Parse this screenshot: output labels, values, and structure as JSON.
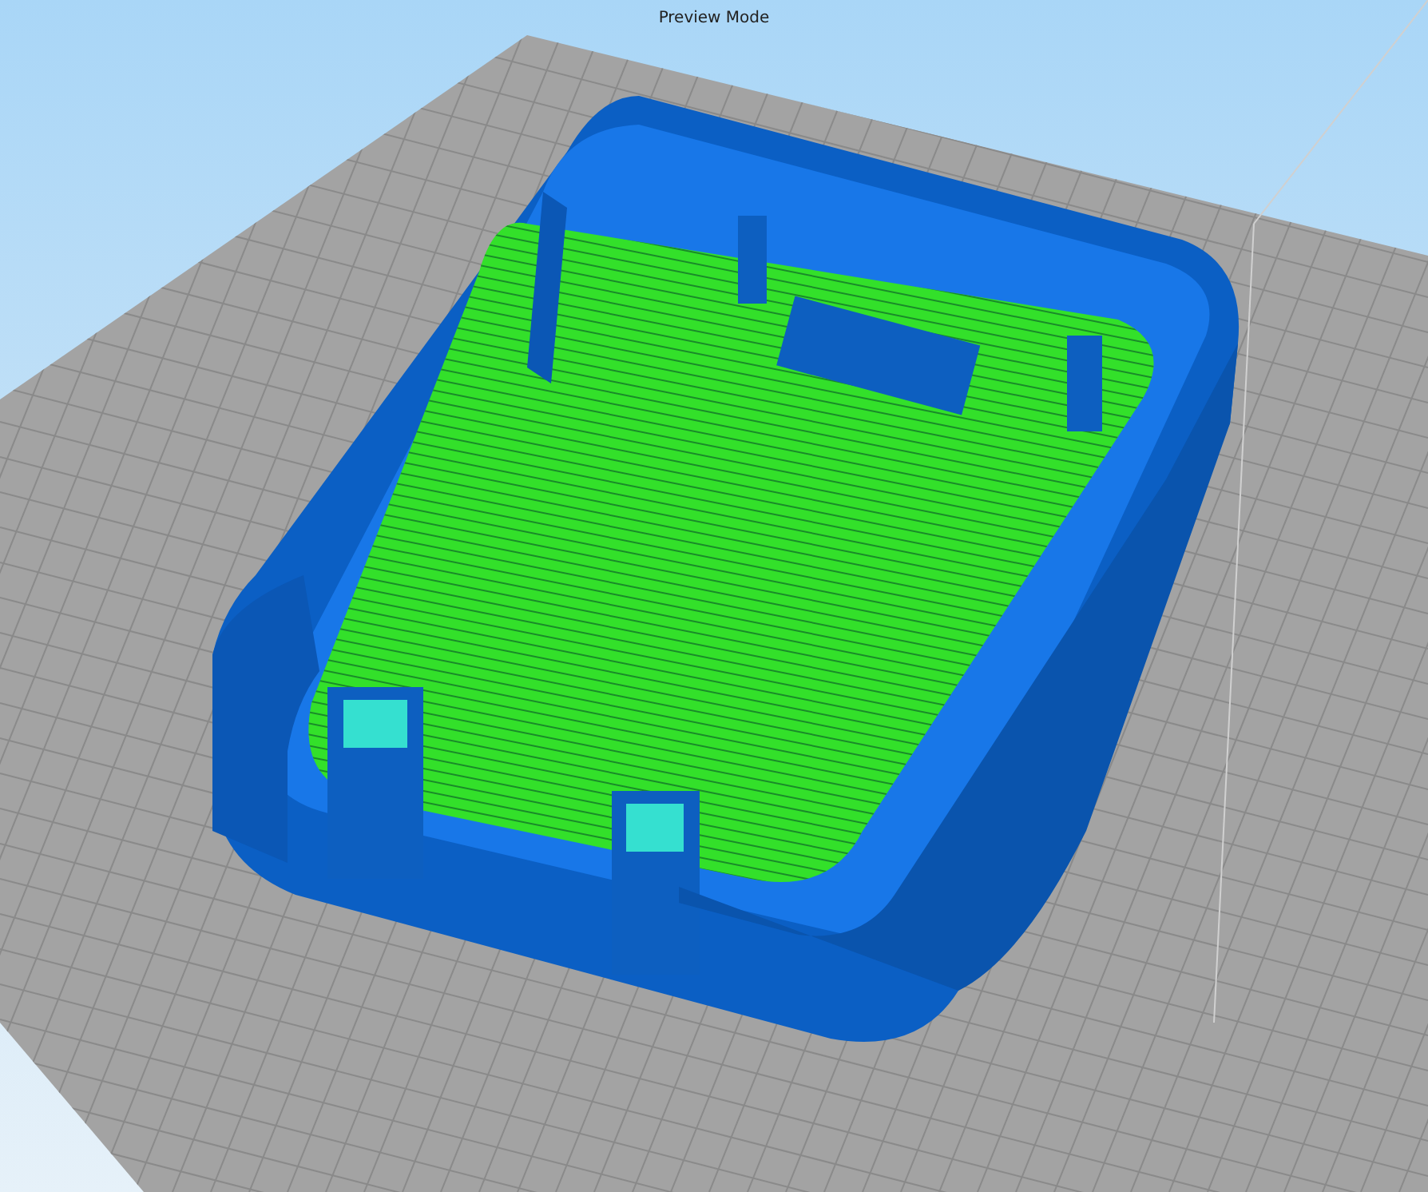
{
  "viewport": {
    "title": "Preview Mode"
  }
}
